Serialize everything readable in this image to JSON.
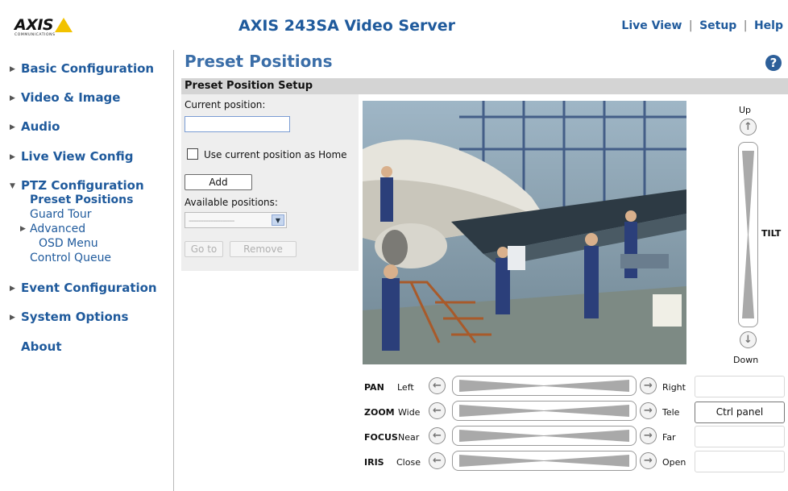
{
  "header": {
    "logo_text": "AXIS",
    "logo_sub": "COMMUNICATIONS",
    "title": "AXIS 243SA Video Server",
    "nav_live": "Live View",
    "nav_setup": "Setup",
    "nav_help": "Help",
    "sep": "|"
  },
  "sidebar": {
    "basic": "Basic Configuration",
    "video": "Video & Image",
    "audio": "Audio",
    "liveview": "Live View Config",
    "ptz": "PTZ Configuration",
    "ptz_preset": "Preset Positions",
    "ptz_guard": "Guard Tour",
    "ptz_advanced": "Advanced",
    "ptz_osd": "OSD Menu",
    "ptz_queue": "Control Queue",
    "event": "Event Configuration",
    "system": "System Options",
    "about": "About"
  },
  "main": {
    "page_title": "Preset Positions",
    "help_glyph": "?",
    "section_title": "Preset Position Setup",
    "current_position_label": "Current position:",
    "current_position_value": "",
    "home_checkbox_label": "Use current position as Home",
    "add_button": "Add",
    "available_label": "Available positions:",
    "select_value": "-------------------",
    "goto_button": "Go to",
    "remove_button": "Remove"
  },
  "ptz": {
    "up": "Up",
    "down": "Down",
    "tilt": "TILT",
    "pan": {
      "name": "PAN",
      "low": "Left",
      "high": "Right"
    },
    "zoom": {
      "name": "ZOOM",
      "low": "Wide",
      "high": "Tele"
    },
    "focus": {
      "name": "FOCUS",
      "low": "Near",
      "high": "Far"
    },
    "iris": {
      "name": "IRIS",
      "low": "Close",
      "high": "Open"
    },
    "ctrl_panel": "Ctrl panel"
  },
  "colors": {
    "brand_blue": "#1f5a9c",
    "logo_yellow": "#f2c200",
    "section_grey": "#d4d4d4"
  }
}
